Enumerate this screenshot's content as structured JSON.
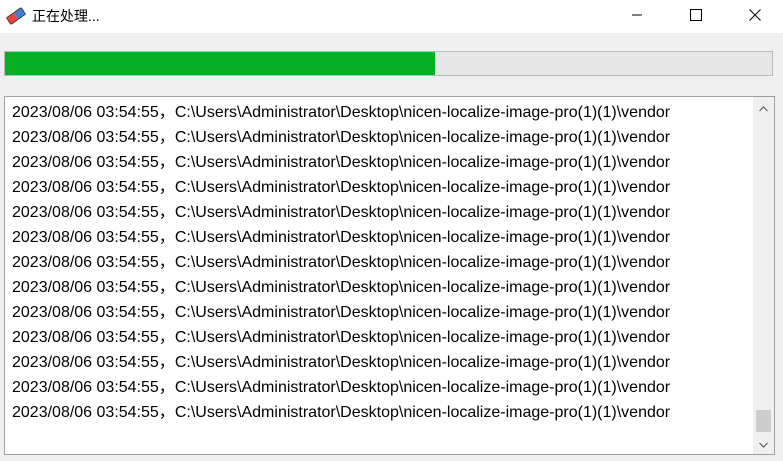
{
  "window": {
    "title": "正在处理...",
    "app_icon": "eraser-icon",
    "controls": {
      "minimize_icon": "minimize-icon",
      "maximize_icon": "maximize-icon",
      "close_icon": "close-icon"
    }
  },
  "progress": {
    "value_fraction": 0.56,
    "fill_color": "#06b025",
    "track_color": "#e6e6e6"
  },
  "log": {
    "lines": [
      {
        "time": "2023/08/06 03:54:55，",
        "path": "C:\\Users\\Administrator\\Desktop\\nicen-localize-image-pro(1)(1)\\vendor"
      },
      {
        "time": "2023/08/06 03:54:55，",
        "path": "C:\\Users\\Administrator\\Desktop\\nicen-localize-image-pro(1)(1)\\vendor"
      },
      {
        "time": "2023/08/06 03:54:55，",
        "path": "C:\\Users\\Administrator\\Desktop\\nicen-localize-image-pro(1)(1)\\vendor"
      },
      {
        "time": "2023/08/06 03:54:55，",
        "path": "C:\\Users\\Administrator\\Desktop\\nicen-localize-image-pro(1)(1)\\vendor"
      },
      {
        "time": "2023/08/06 03:54:55，",
        "path": "C:\\Users\\Administrator\\Desktop\\nicen-localize-image-pro(1)(1)\\vendor"
      },
      {
        "time": "2023/08/06 03:54:55，",
        "path": "C:\\Users\\Administrator\\Desktop\\nicen-localize-image-pro(1)(1)\\vendor"
      },
      {
        "time": "2023/08/06 03:54:55，",
        "path": "C:\\Users\\Administrator\\Desktop\\nicen-localize-image-pro(1)(1)\\vendor"
      },
      {
        "time": "2023/08/06 03:54:55，",
        "path": "C:\\Users\\Administrator\\Desktop\\nicen-localize-image-pro(1)(1)\\vendor"
      },
      {
        "time": "2023/08/06 03:54:55，",
        "path": "C:\\Users\\Administrator\\Desktop\\nicen-localize-image-pro(1)(1)\\vendor"
      },
      {
        "time": "2023/08/06 03:54:55，",
        "path": "C:\\Users\\Administrator\\Desktop\\nicen-localize-image-pro(1)(1)\\vendor"
      },
      {
        "time": "2023/08/06 03:54:55，",
        "path": "C:\\Users\\Administrator\\Desktop\\nicen-localize-image-pro(1)(1)\\vendor"
      },
      {
        "time": "2023/08/06 03:54:55，",
        "path": "C:\\Users\\Administrator\\Desktop\\nicen-localize-image-pro(1)(1)\\vendor"
      },
      {
        "time": "2023/08/06 03:54:55，",
        "path": "C:\\Users\\Administrator\\Desktop\\nicen-localize-image-pro(1)(1)\\vendor"
      }
    ],
    "scroll_icons": {
      "up": "scroll-up-arrow-icon",
      "down": "scroll-down-arrow-icon"
    }
  }
}
